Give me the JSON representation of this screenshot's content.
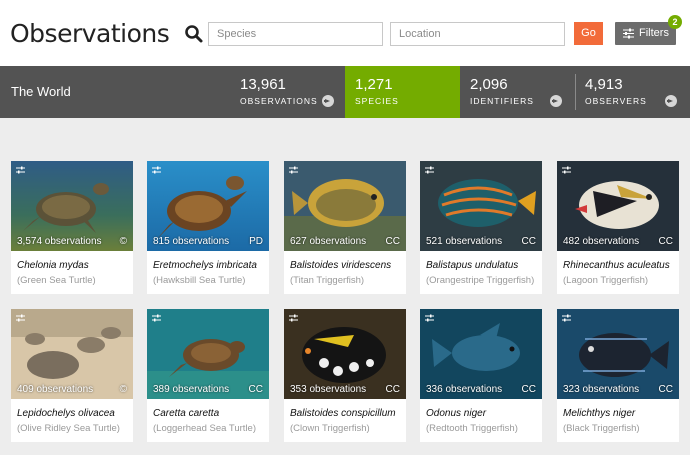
{
  "header": {
    "title": "Observations",
    "species_placeholder": "Species",
    "location_placeholder": "Location",
    "go_label": "Go",
    "filters_label": "Filters",
    "filters_badge": "2"
  },
  "stats": {
    "place": "The World",
    "observations": {
      "value": "13,961",
      "label": "OBSERVATIONS"
    },
    "species": {
      "value": "1,271",
      "label": "SPECIES"
    },
    "identifiers": {
      "value": "2,096",
      "label": "IDENTIFIERS"
    },
    "observers": {
      "value": "4,913",
      "label": "OBSERVERS"
    }
  },
  "colors": {
    "accent": "#74ac00",
    "go": "#f26b3a",
    "bar": "#535353"
  },
  "cards": [
    {
      "obs": "3,574 observations",
      "license": "©",
      "sci": "Chelonia mydas",
      "common": "(Green Sea Turtle)"
    },
    {
      "obs": "815 observations",
      "license": "PD",
      "sci": "Eretmochelys imbricata",
      "common": "(Hawksbill Sea Turtle)"
    },
    {
      "obs": "627 observations",
      "license": "CC",
      "sci": "Balistoides viridescens",
      "common": "(Titan Triggerfish)"
    },
    {
      "obs": "521 observations",
      "license": "CC",
      "sci": "Balistapus undulatus",
      "common": "(Orangestripe Triggerfish)"
    },
    {
      "obs": "482 observations",
      "license": "CC",
      "sci": "Rhinecanthus aculeatus",
      "common": "(Lagoon Triggerfish)"
    },
    {
      "obs": "409 observations",
      "license": "©",
      "sci": "Lepidochelys olivacea",
      "common": "(Olive Ridley Sea Turtle)"
    },
    {
      "obs": "389 observations",
      "license": "CC",
      "sci": "Caretta caretta",
      "common": "(Loggerhead Sea Turtle)"
    },
    {
      "obs": "353 observations",
      "license": "CC",
      "sci": "Balistoides conspicillum",
      "common": "(Clown Triggerfish)"
    },
    {
      "obs": "336 observations",
      "license": "CC",
      "sci": "Odonus niger",
      "common": "(Redtooth Triggerfish)"
    },
    {
      "obs": "323 observations",
      "license": "CC",
      "sci": "Melichthys niger",
      "common": "(Black Triggerfish)"
    }
  ]
}
